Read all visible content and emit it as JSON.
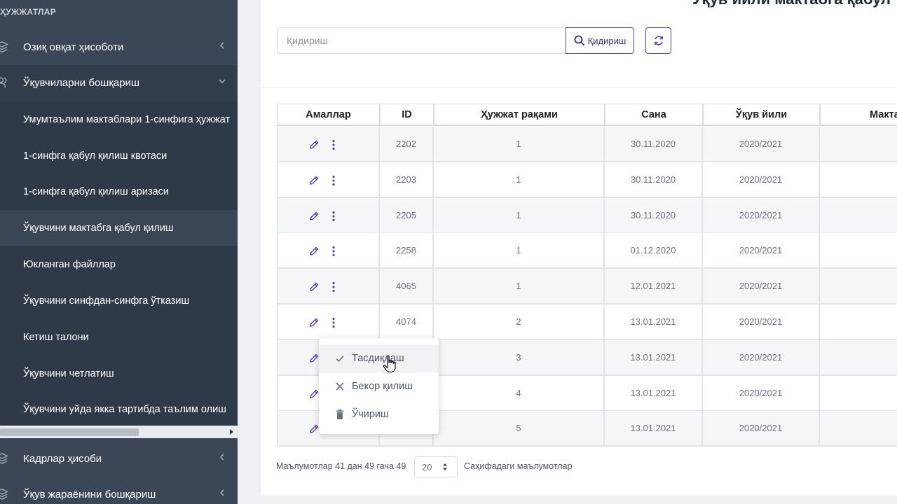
{
  "sidebar": {
    "header": "ҲУЖЖАТЛАР",
    "groups_top": [
      {
        "label": "Озиқ овқат ҳисоботи",
        "icon": "layers-icon"
      },
      {
        "label": "Ўқувчиларни бошқариш",
        "icon": "users-icon"
      }
    ],
    "items": [
      {
        "label": "Умумтаълим мактаблари 1-синфига ҳужжат"
      },
      {
        "label": "1-синфга қабул қилиш квотаси"
      },
      {
        "label": "1-синфга қабул қилиш аризаси"
      },
      {
        "label": "Ўқувчини мактабга қабул қилиш"
      },
      {
        "label": "Юкланган файллар"
      },
      {
        "label": "Ўқувчини синфдан-синфга ўтказиш"
      },
      {
        "label": "Кетиш талони"
      },
      {
        "label": "Ўқувчини четлатиш"
      },
      {
        "label": "Ўқувчини уйда якка тартибда таълим олиш"
      }
    ],
    "groups_bottom": [
      {
        "label": "Кадрлар ҳисоби",
        "icon": "layers-icon"
      },
      {
        "label": "Ўқув жараёнини бошқариш",
        "icon": "layers-icon"
      }
    ]
  },
  "main": {
    "title": "Ўқув йили мактабга қабул",
    "search": {
      "placeholder": "Қидириш",
      "button_label": "Қидириш"
    }
  },
  "table": {
    "columns": [
      "Амаллар",
      "ID",
      "Ҳужжат рақами",
      "Сана",
      "Ўқув йили",
      "Мактаб"
    ],
    "rows": [
      {
        "id": "2202",
        "doc": "1",
        "date": "30.11.2020",
        "year": "2020/2021"
      },
      {
        "id": "2203",
        "doc": "1",
        "date": "30.11.2020",
        "year": "2020/2021"
      },
      {
        "id": "2205",
        "doc": "1",
        "date": "30.11.2020",
        "year": "2020/2021"
      },
      {
        "id": "2258",
        "doc": "1",
        "date": "01.12.2020",
        "year": "2020/2021"
      },
      {
        "id": "4065",
        "doc": "1",
        "date": "12.01.2021",
        "year": "2020/2021"
      },
      {
        "id": "4074",
        "doc": "2",
        "date": "13.01.2021",
        "year": "2020/2021"
      },
      {
        "id": "",
        "doc": "3",
        "date": "13.01.2021",
        "year": "2020/2021"
      },
      {
        "id": "",
        "doc": "4",
        "date": "13.01.2021",
        "year": "2020/2021"
      },
      {
        "id": "",
        "doc": "5",
        "date": "13.01.2021",
        "year": "2020/2021"
      }
    ]
  },
  "menu": {
    "items": [
      {
        "label": "Тасдиқлаш",
        "icon": "check-icon"
      },
      {
        "label": "Бекор қилиш",
        "icon": "close-icon"
      },
      {
        "label": "Ўчириш",
        "icon": "trash-icon"
      }
    ]
  },
  "footer": {
    "info": "Маълумотлар 41 дан 49 гача 49",
    "page_size": "20",
    "page_size_label": "Саҳифадаги маълумотлар"
  },
  "colors": {
    "accent": "#5a3fb8",
    "sidebar": "#3b4756"
  }
}
